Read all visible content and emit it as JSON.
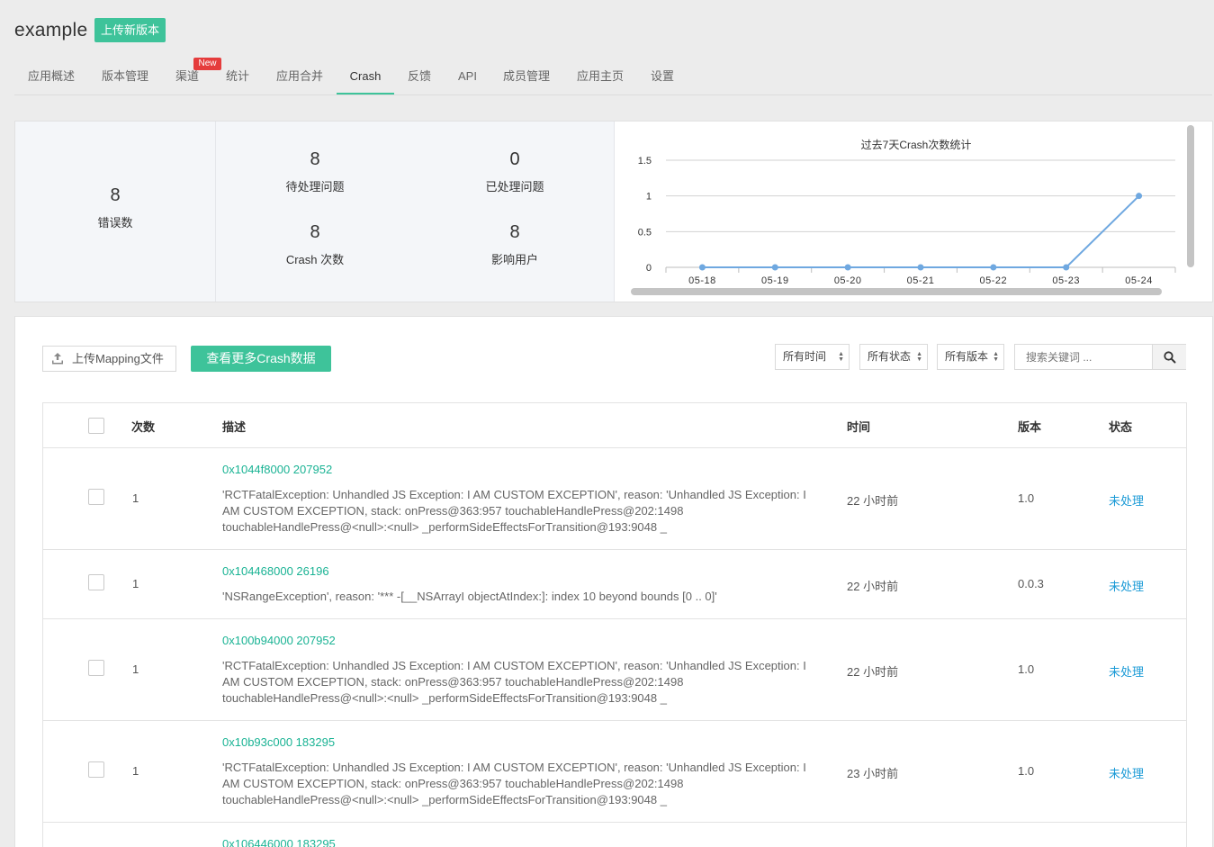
{
  "app": {
    "title": "example",
    "upload_label": "上传新版本"
  },
  "tabs": [
    {
      "label": "应用概述"
    },
    {
      "label": "版本管理"
    },
    {
      "label": "渠道"
    },
    {
      "label": "统计"
    },
    {
      "label": "应用合并"
    },
    {
      "label": "Crash"
    },
    {
      "label": "反馈"
    },
    {
      "label": "API"
    },
    {
      "label": "成员管理"
    },
    {
      "label": "应用主页"
    },
    {
      "label": "设置"
    }
  ],
  "active_tab": "Crash",
  "new_badge": "New",
  "stats": {
    "errors": {
      "value": "8",
      "label": "错误数"
    },
    "pending": {
      "value": "8",
      "label": "待处理问题"
    },
    "handled": {
      "value": "0",
      "label": "已处理问题"
    },
    "crashes": {
      "value": "8",
      "label": "Crash 次数"
    },
    "users": {
      "value": "8",
      "label": "影响用户"
    }
  },
  "chart_data": {
    "type": "line",
    "title": "过去7天Crash次数统计",
    "categories": [
      "05-18",
      "05-19",
      "05-20",
      "05-21",
      "05-22",
      "05-23",
      "05-24"
    ],
    "values": [
      0,
      0,
      0,
      0,
      0,
      0,
      1
    ],
    "yticks": [
      "0",
      "0.5",
      "1",
      "1.5"
    ],
    "ylim": [
      0,
      1.5
    ],
    "grid": true,
    "color": "#6fa8e0"
  },
  "toolbar": {
    "mapping_label": "上传Mapping文件",
    "more_label": "查看更多Crash数据",
    "filter_time": "所有时间",
    "filter_status": "所有状态",
    "filter_version": "所有版本",
    "search_placeholder": "搜索关键词 ..."
  },
  "table": {
    "headers": {
      "count": "次数",
      "desc": "描述",
      "time": "时间",
      "version": "版本",
      "status": "状态"
    },
    "rows": [
      {
        "count": "1",
        "addr": "0x1044f8000 207952",
        "desc": "'RCTFatalException: Unhandled JS Exception: I AM CUSTOM EXCEPTION', reason: 'Unhandled JS Exception: I AM CUSTOM EXCEPTION, stack: onPress@363:957 touchableHandlePress@202:1498 touchableHandlePress@<null>:<null> _performSideEffectsForTransition@193:9048 _",
        "time": "22 小时前",
        "version": "1.0",
        "status": "未处理"
      },
      {
        "count": "1",
        "addr": "0x104468000 26196",
        "desc": "'NSRangeException', reason: '*** -[__NSArrayI objectAtIndex:]: index 10 beyond bounds [0 .. 0]'",
        "time": "22 小时前",
        "version": "0.0.3",
        "status": "未处理"
      },
      {
        "count": "1",
        "addr": "0x100b94000 207952",
        "desc": "'RCTFatalException: Unhandled JS Exception: I AM CUSTOM EXCEPTION', reason: 'Unhandled JS Exception: I AM CUSTOM EXCEPTION, stack: onPress@363:957 touchableHandlePress@202:1498 touchableHandlePress@<null>:<null> _performSideEffectsForTransition@193:9048 _",
        "time": "22 小时前",
        "version": "1.0",
        "status": "未处理"
      },
      {
        "count": "1",
        "addr": "0x10b93c000 183295",
        "desc": "'RCTFatalException: Unhandled JS Exception: I AM CUSTOM EXCEPTION', reason: 'Unhandled JS Exception: I AM CUSTOM EXCEPTION, stack: onPress@363:957 touchableHandlePress@202:1498 touchableHandlePress@<null>:<null> _performSideEffectsForTransition@193:9048 _",
        "time": "23 小时前",
        "version": "1.0",
        "status": "未处理"
      },
      {
        "count": "",
        "addr": "0x106446000 183295",
        "desc": "",
        "time": "",
        "version": "",
        "status": ""
      }
    ]
  }
}
